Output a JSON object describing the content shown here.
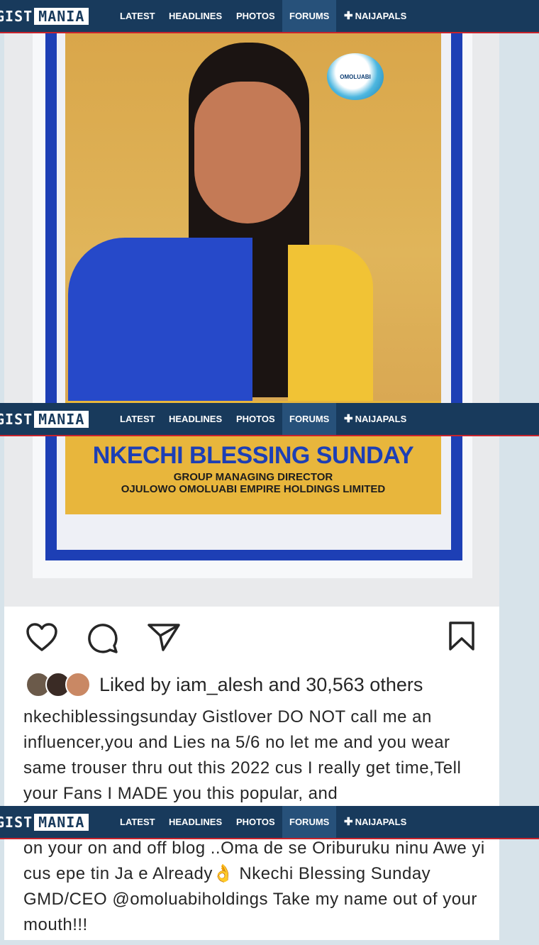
{
  "navbar": {
    "logo_part1": "GIST",
    "logo_part2": "MANIA",
    "items": [
      {
        "label": "LATEST"
      },
      {
        "label": "HEADLINES"
      },
      {
        "label": "PHOTOS"
      },
      {
        "label": "FORUMS",
        "active": true
      },
      {
        "label": "NAIJAPALS",
        "icon": "plus-icon"
      }
    ]
  },
  "poster": {
    "badge_text": "OMOLUABI",
    "name": "NKECHI BLESSING SUNDAY",
    "role": "GROUP MANAGING DIRECTOR",
    "company": "OJULOWO OMOLUABI EMPIRE HOLDINGS LIMITED"
  },
  "instagram": {
    "actions": [
      "heart-icon",
      "comment-icon",
      "share-icon",
      "bookmark-icon"
    ],
    "liked_prefix": "Liked by ",
    "liked_user": "iam_alesh",
    "liked_mid": " and ",
    "liked_count": "30,563 others",
    "caption_user": "nkechiblessingsunday",
    "caption_text": " Gistlover DO NOT call me an influencer,you and Lies na 5/6 no let me and you wear same trouser thru out this  2022 cus I really get time,Tell your Fans I MADE you this popular, and",
    "caption_text_2": "on your on and off blog ..Oma de se Oriburuku ninu Awe yi  cus epe tin Ja e Already👌 Nkechi Blessing Sunday GMD/CEO ",
    "caption_mention": "@omoluabiholdings",
    "caption_text_3": " Take my name out of your mouth!!!"
  },
  "colors": {
    "nav_bg": "#183a5c",
    "nav_active": "#27517a",
    "nav_border": "#c8232c",
    "page_bg": "#d7e3ea",
    "poster_blue": "#1d3fb5",
    "poster_yellow": "#e8b63c"
  }
}
